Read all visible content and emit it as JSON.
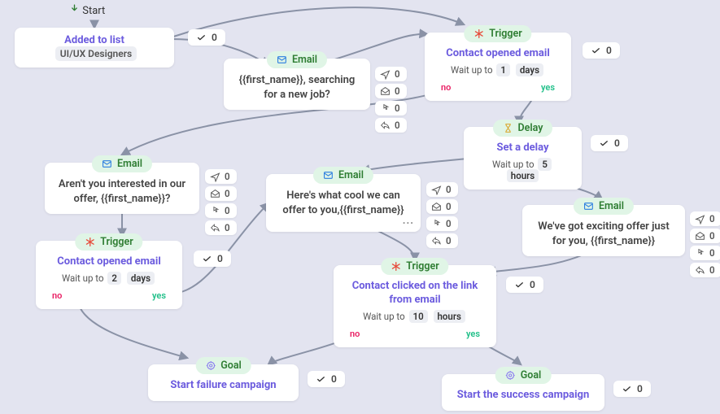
{
  "labels": {
    "start": "Start",
    "email": "Email",
    "trigger": "Trigger",
    "delay": "Delay",
    "goal": "Goal",
    "no": "no",
    "yes": "yes",
    "wait_prefix": "Wait up to",
    "added_to_list": "Added to list",
    "list_name": "UI/UX Designers"
  },
  "stats": {
    "zero": "0"
  },
  "nodes": {
    "email1": {
      "body": "{{first_name}}, searching for a new job?"
    },
    "trigger1": {
      "title": "Contact opened email",
      "wait_num": "1",
      "wait_unit": "days"
    },
    "delay1": {
      "title": "Set a delay",
      "wait_num": "5",
      "wait_unit": "hours"
    },
    "email2": {
      "body": "Aren't you interested in our offer, {{first_name}}?"
    },
    "email3": {
      "body": "Here's what cool we can offer to you,{{first_name}}"
    },
    "email4": {
      "body": "We've got exciting offer just for you, {{first_name}}"
    },
    "trigger2": {
      "title": "Contact opened email",
      "wait_num": "2",
      "wait_unit": "days"
    },
    "trigger3": {
      "title": "Contact clicked on the link from email",
      "wait_num": "10",
      "wait_unit": "hours"
    },
    "goal1": {
      "title": "Start failure campaign"
    },
    "goal2": {
      "title": "Start the success campaign"
    }
  }
}
